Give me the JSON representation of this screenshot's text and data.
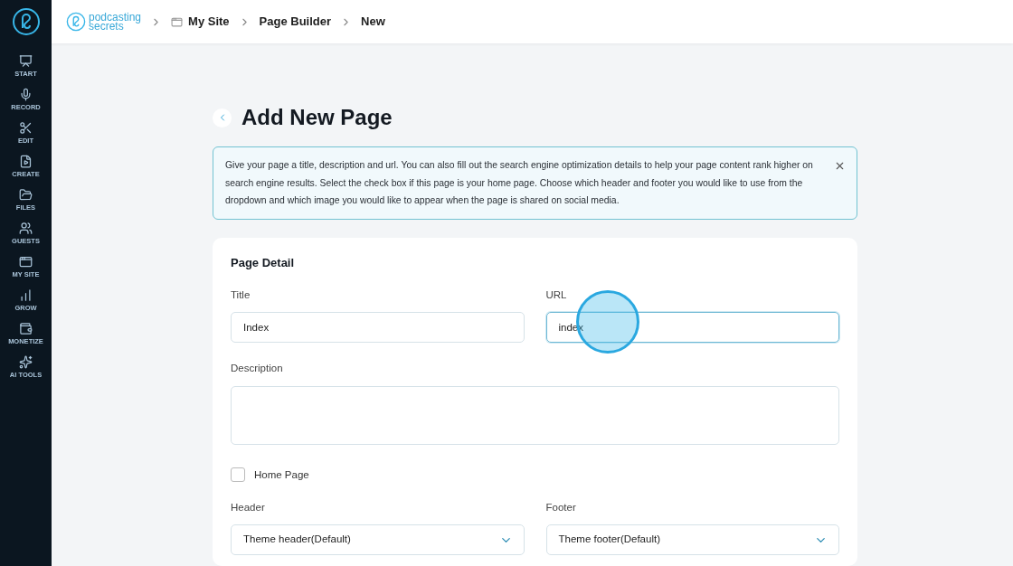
{
  "brand": {
    "line1": "podcasting",
    "line2": "secrets"
  },
  "sidebar": {
    "items": [
      {
        "label": "START"
      },
      {
        "label": "RECORD"
      },
      {
        "label": "EDIT"
      },
      {
        "label": "CREATE"
      },
      {
        "label": "FILES"
      },
      {
        "label": "GUESTS"
      },
      {
        "label": "MY SITE"
      },
      {
        "label": "GROW"
      },
      {
        "label": "MONETIZE"
      },
      {
        "label": "AI TOOLS"
      }
    ]
  },
  "breadcrumbs": [
    {
      "label": "My Site"
    },
    {
      "label": "Page Builder"
    },
    {
      "label": "New"
    }
  ],
  "page_title": "Add New Page",
  "info_alert": "Give your page a title, description and url. You can also fill out the search engine optimization details to help your page content rank higher on search engine results. Select the check box if this page is your home page. Choose which header and footer you would like to use from the dropdown and which image you would like to appear when the page is shared on social media.",
  "card": {
    "title": "Page Detail",
    "title_field": {
      "label": "Title",
      "value": "Index"
    },
    "url_field": {
      "label": "URL",
      "value": "index",
      "focused": true
    },
    "description_field": {
      "label": "Description"
    },
    "home_page": {
      "label": "Home Page",
      "checked": false
    },
    "header_select": {
      "label": "Header",
      "value": "Theme header(Default)"
    },
    "footer_select": {
      "label": "Footer",
      "value": "Theme footer(Default)"
    }
  },
  "click_indicator": {
    "shown": true
  }
}
